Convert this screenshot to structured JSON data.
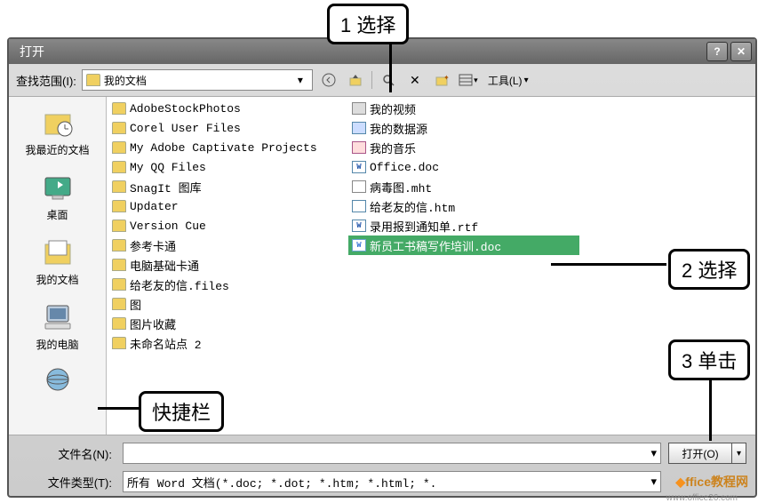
{
  "callouts": {
    "c1": "1 选择",
    "c2": "2 选择",
    "c3": "3 单击",
    "quickbar": "快捷栏"
  },
  "titlebar": {
    "title": "打开"
  },
  "toolbar": {
    "lookin_label": "查找范围(I):",
    "lookin_value": "我的文档",
    "tools_label": "工具(L)"
  },
  "places": [
    {
      "label": "我最近的文档",
      "icon": "recent"
    },
    {
      "label": "桌面",
      "icon": "desktop"
    },
    {
      "label": "我的文档",
      "icon": "mydocs"
    },
    {
      "label": "我的电脑",
      "icon": "mycomputer"
    },
    {
      "label": "",
      "icon": "network"
    }
  ],
  "files_col1": [
    {
      "name": "AdobeStockPhotos",
      "type": "folder"
    },
    {
      "name": "Corel User Files",
      "type": "folder"
    },
    {
      "name": "My Adobe Captivate Projects",
      "type": "folder"
    },
    {
      "name": "My QQ Files",
      "type": "folder"
    },
    {
      "name": "SnagIt 图库",
      "type": "folder"
    },
    {
      "name": "Updater",
      "type": "folder"
    },
    {
      "name": "Version Cue",
      "type": "folder"
    },
    {
      "name": "参考卡通",
      "type": "folder"
    },
    {
      "name": "电脑基础卡通",
      "type": "folder"
    },
    {
      "name": "给老友的信.files",
      "type": "folder"
    },
    {
      "name": "图",
      "type": "folder"
    },
    {
      "name": "图片收藏",
      "type": "folder"
    },
    {
      "name": "未命名站点 2",
      "type": "folder"
    }
  ],
  "files_col2": [
    {
      "name": "我的视频",
      "type": "video"
    },
    {
      "name": "我的数据源",
      "type": "db"
    },
    {
      "name": "我的音乐",
      "type": "music"
    },
    {
      "name": "Office.doc",
      "type": "doc"
    },
    {
      "name": "病毒图.mht",
      "type": "mht"
    },
    {
      "name": "给老友的信.htm",
      "type": "htm"
    },
    {
      "name": "录用报到通知单.rtf",
      "type": "doc"
    },
    {
      "name": "新员工书稿写作培训.doc",
      "type": "doc",
      "selected": true
    }
  ],
  "bottom": {
    "filename_label": "文件名(N):",
    "filename_value": "",
    "filetype_label": "文件类型(T):",
    "filetype_value": "所有 Word 文档(*.doc; *.dot; *.htm; *.html; *.",
    "open_label": "打开(O)"
  },
  "watermark": {
    "main": "ffice教程网",
    "sub": "www.office26.com"
  }
}
